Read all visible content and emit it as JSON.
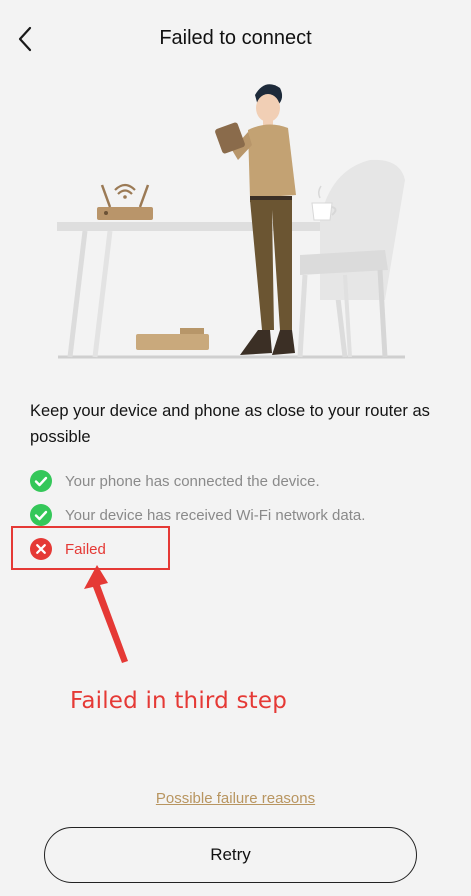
{
  "header": {
    "title": "Failed to connect",
    "back_icon": "chevron-left-icon"
  },
  "headline": "Keep your device and phone as close to your router as possible",
  "steps": [
    {
      "label": "Your phone has connected the device.",
      "status": "success",
      "icon": "check-circle-icon"
    },
    {
      "label": "Your device has received Wi-Fi network data.",
      "status": "success",
      "icon": "check-circle-icon"
    },
    {
      "label": "Failed",
      "status": "failed",
      "icon": "x-circle-icon"
    }
  ],
  "annotation": {
    "text": "Failed in third step"
  },
  "footer": {
    "reasons_link": "Possible failure reasons",
    "retry_label": "Retry"
  },
  "colors": {
    "background": "#f3f3f3",
    "success": "#34c759",
    "error": "#e53935",
    "link": "#b89560"
  }
}
